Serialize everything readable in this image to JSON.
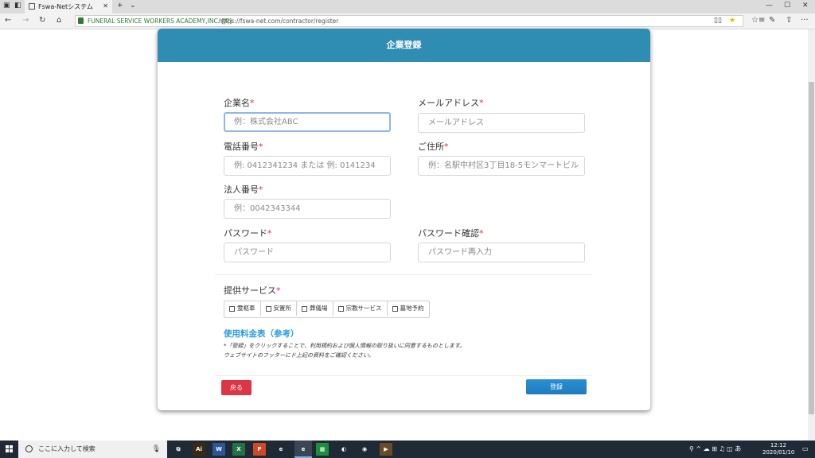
{
  "browser": {
    "tab_title": "Fswa-Netシステム",
    "tab_close": "✕",
    "new_tab": "+",
    "tab_menu": "⌄",
    "win_min": "—",
    "win_max": "☐",
    "win_close": "✕",
    "back": "←",
    "forward": "→",
    "refresh": "↻",
    "home": "⌂",
    "cert_name": "FUNERAL SERVICE WORKERS ACADEMY,INC. [JP]",
    "url": "https://fswa-net.com/contractor/register",
    "reading_icon": "▯▯",
    "favorite_icon": "★",
    "favorites_list_icon": "☆≡",
    "notes_icon": "✎",
    "share_icon": "⇪",
    "more_icon": "···"
  },
  "form": {
    "header_title": "企業登録",
    "required_mark": "*",
    "company_name_label": "企業名",
    "company_name_placeholder": "例：株式会社ABC",
    "email_label": "メールアドレス",
    "email_placeholder": "メールアドレス",
    "phone_label": "電話番号",
    "phone_placeholder": "例: 0412341234 または 例: 0141234",
    "address_label": "ご住所",
    "address_placeholder": "例：名駅中村区3丁目18-5モンマートビル",
    "corp_number_label": "法人番号",
    "corp_number_placeholder": "例：0042343344",
    "password_label": "パスワード",
    "password_placeholder": "パスワード",
    "password_confirm_label": "パスワード確認",
    "password_confirm_placeholder": "パスワード再入力",
    "services_label": "提供サービス",
    "services": [
      "霊柩車",
      "安置所",
      "葬儀場",
      "宗教サービス",
      "墓地予約"
    ],
    "fee_link": "使用料金表（参考）",
    "note_line1": "*「登録」をクリックすることで、利用規約および個人情報の取り扱いに同意するものとします。",
    "note_line2": "ウェブサイトのフッターにド上記の資料をご確認ください。",
    "back_button": "戻る",
    "register_button": "登録"
  },
  "taskbar": {
    "search_placeholder": "ここに入力して検索",
    "mic": "🎙",
    "apps": [
      {
        "name": "task-view",
        "label": "⧉",
        "color": "#1f2a36"
      },
      {
        "name": "illustrator",
        "label": "Ai",
        "color": "#3a2a12"
      },
      {
        "name": "word",
        "label": "W",
        "color": "#2b579a"
      },
      {
        "name": "excel",
        "label": "X",
        "color": "#217346"
      },
      {
        "name": "powerpoint",
        "label": "P",
        "color": "#d24726"
      },
      {
        "name": "ie",
        "label": "e",
        "color": "#1f2a36"
      },
      {
        "name": "edge",
        "label": "e",
        "color": "#3a4653"
      },
      {
        "name": "sheets",
        "label": "▦",
        "color": "#1e8e3e"
      },
      {
        "name": "photos",
        "label": "◐",
        "color": "#1f2a36"
      },
      {
        "name": "chrome",
        "label": "◉",
        "color": "#1f2a36"
      },
      {
        "name": "media",
        "label": "▶",
        "color": "#6b4a2b"
      }
    ],
    "tray_icons": "⚲  ^  ☁  ⊞  ♫  ◫  あ",
    "time": "12:12",
    "date": "2020/01/10",
    "notification_icon": "▭"
  },
  "colors": {
    "header": "#2f8cb2",
    "required": "#e03030",
    "link": "#2a9ee2",
    "back_button": "#dc3545",
    "register_button": "#1f7bc0"
  }
}
